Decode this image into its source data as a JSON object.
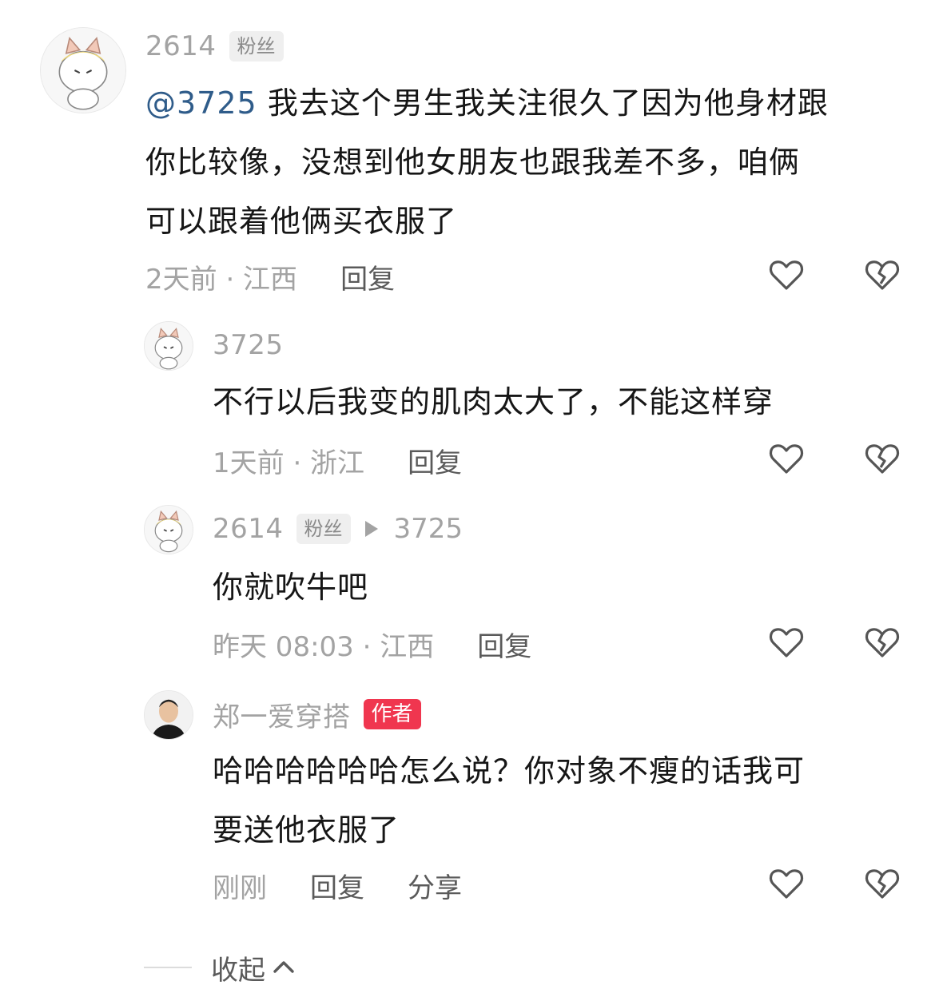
{
  "comments": [
    {
      "username": "2614",
      "badge": "粉丝",
      "mention": "@3725",
      "lines": [
        "我去这个男生我关注很久了因为他身材跟",
        "你比较像，没想到他女朋友也跟我差不多，咱俩",
        "可以跟着他俩买衣服了"
      ],
      "meta": "2天前 · 江西",
      "reply_label": "回复"
    },
    {
      "username": "3725",
      "lines": [
        "不行以后我变的肌肉太大了，不能这样穿"
      ],
      "meta": "1天前 · 浙江",
      "reply_label": "回复"
    },
    {
      "username": "2614",
      "badge": "粉丝",
      "reply_target": "3725",
      "lines": [
        "你就吹牛吧"
      ],
      "meta": "昨天 08:03 · 江西",
      "reply_label": "回复"
    },
    {
      "username": "郑一爱穿搭",
      "author_badge": "作者",
      "lines": [
        "哈哈哈哈哈哈怎么说？你对象不瘦的话我可",
        "要送他衣服了"
      ],
      "meta": "刚刚",
      "reply_label": "回复",
      "share_label": "分享"
    }
  ],
  "collapse_label": "收起",
  "icons": {
    "like": "heart-outline-icon",
    "dislike": "broken-heart-icon",
    "collapse": "chevron-up-icon"
  },
  "colors": {
    "author_badge": "#f0364f",
    "mention": "#2f5c8a",
    "muted_text": "#a3a3a3"
  }
}
